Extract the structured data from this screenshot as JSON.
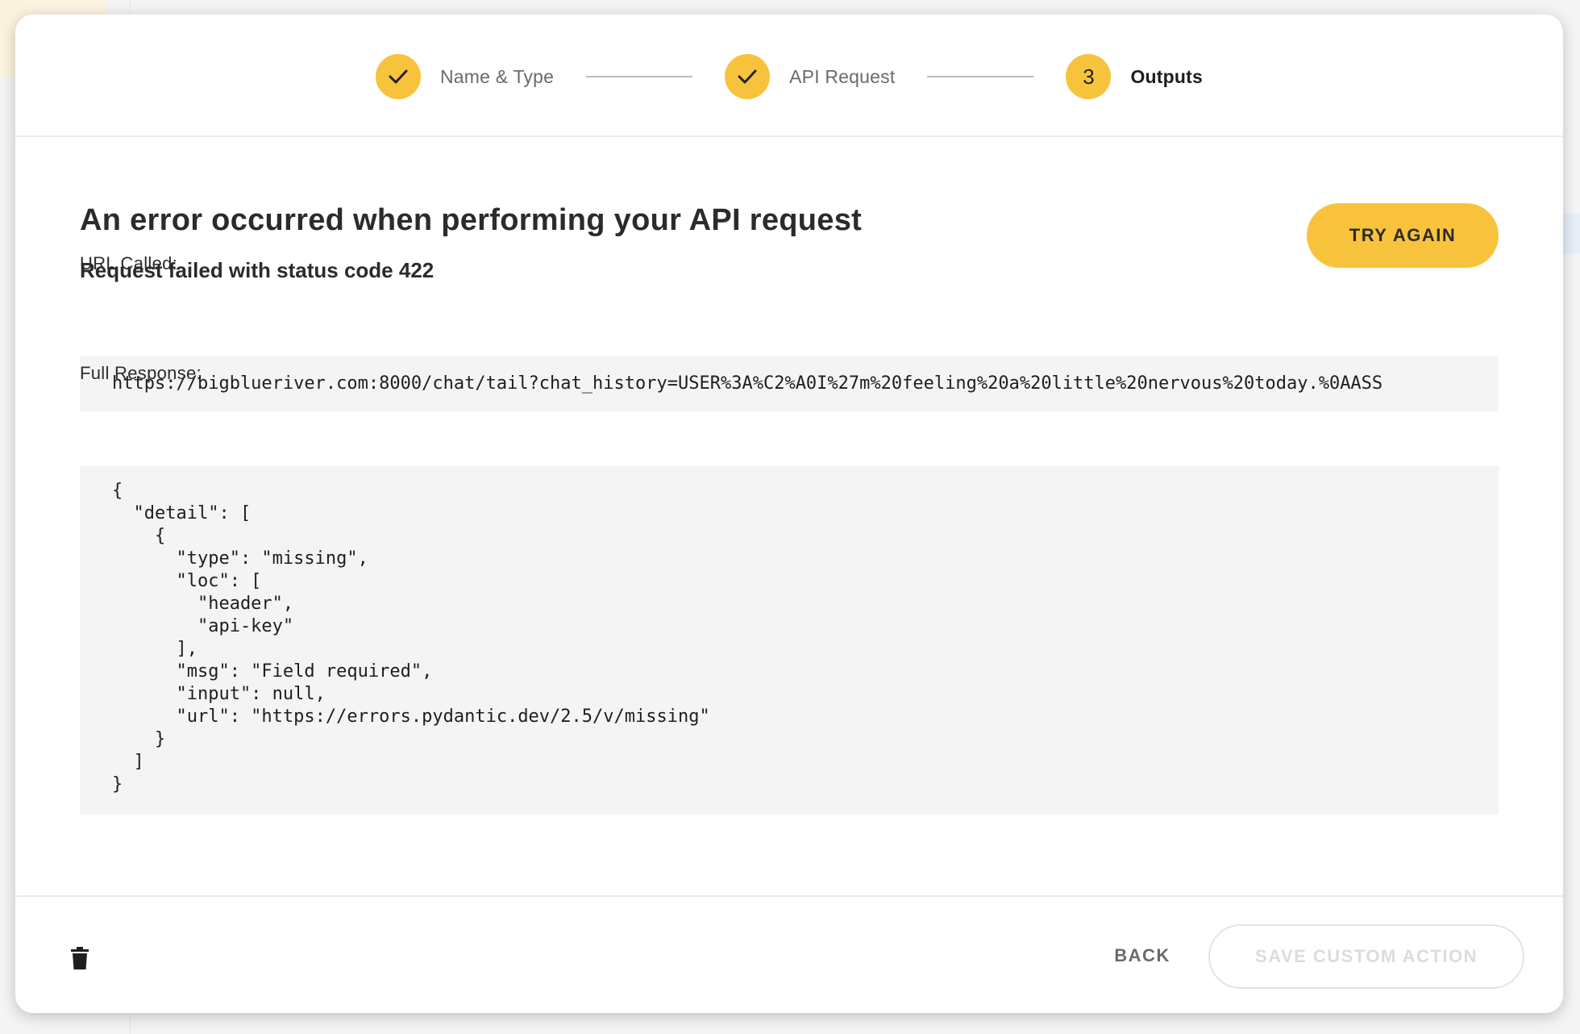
{
  "stepper": {
    "steps": [
      {
        "label": "Name & Type",
        "state": "done"
      },
      {
        "label": "API Request",
        "state": "done"
      },
      {
        "label": "Outputs",
        "state": "active",
        "number": "3"
      }
    ]
  },
  "error": {
    "title": "An error occurred when performing your API request",
    "subtitle": "Request failed with status code 422",
    "try_again_label": "TRY AGAIN"
  },
  "url_section": {
    "label": "URL Called:",
    "value": "https://bigblueriver.com:8000/chat/tail?chat_history=USER%3A%C2%A0I%27m%20feeling%20a%20little%20nervous%20today.%0AASS"
  },
  "response_section": {
    "label": "Full Response:",
    "body": "{\n  \"detail\": [\n    {\n      \"type\": \"missing\",\n      \"loc\": [\n        \"header\",\n        \"api-key\"\n      ],\n      \"msg\": \"Field required\",\n      \"input\": null,\n      \"url\": \"https://errors.pydantic.dev/2.5/v/missing\"\n    }\n  ]\n}"
  },
  "footer": {
    "back_label": "BACK",
    "save_label": "SAVE CUSTOM ACTION",
    "delete_icon": "trash-icon"
  },
  "colors": {
    "accent": "#f8c33c",
    "text": "#2b2b2b",
    "muted": "#6b6b6b",
    "code_bg": "#f4f4f4"
  }
}
